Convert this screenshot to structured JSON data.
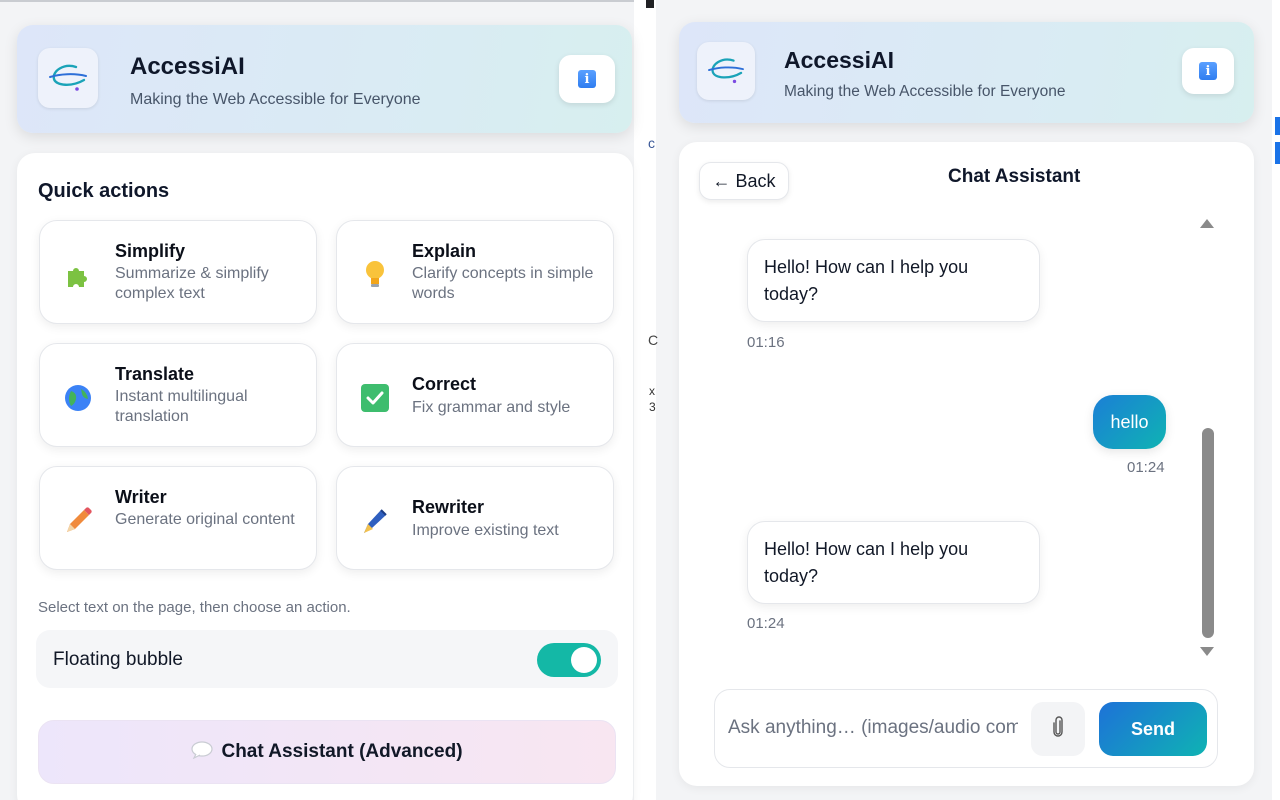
{
  "app": {
    "title": "AccessiAI",
    "subtitle": "Making the Web Accessible for Everyone",
    "logo_icon": "orbit-logo-icon",
    "info_icon": "info-icon",
    "info_glyph": "i"
  },
  "left_panel": {
    "section_title": "Quick actions",
    "actions": [
      {
        "title": "Simplify",
        "description": "Summarize & simplify complex text",
        "icon": "puzzle-piece-icon"
      },
      {
        "title": "Explain",
        "description": "Clarify concepts in simple words",
        "icon": "lightbulb-icon"
      },
      {
        "title": "Translate",
        "description": "Instant multilingual translation",
        "icon": "globe-icon"
      },
      {
        "title": "Correct",
        "description": "Fix grammar and style",
        "icon": "checkmark-box-icon"
      },
      {
        "title": "Writer",
        "description": "Generate original content",
        "icon": "pencil-icon"
      },
      {
        "title": "Rewriter",
        "description": "Improve existing text",
        "icon": "pen-icon"
      }
    ],
    "hint": "Select text on the page, then choose an action.",
    "floating_bubble": {
      "label": "Floating bubble",
      "enabled": true
    },
    "chat_button": {
      "label": "Chat Assistant (Advanced)",
      "icon": "speech-bubble-icon"
    }
  },
  "chat_panel": {
    "back_label": "← Back",
    "title": "Chat Assistant",
    "messages": [
      {
        "role": "assistant",
        "text": "Hello! How can I help you today?",
        "time": "01:16"
      },
      {
        "role": "user",
        "text": "hello",
        "time": "01:24"
      },
      {
        "role": "assistant",
        "text": "Hello! How can I help you today?",
        "time": "01:24"
      }
    ],
    "input": {
      "placeholder": "Ask anything… (images/audio com",
      "value": ""
    },
    "attach_icon": "paperclip-icon",
    "send_label": "Send"
  },
  "background_page": {
    "fragments": [
      "c",
      "C",
      "x",
      "3"
    ]
  },
  "colors": {
    "accent_teal": "#14b8a6",
    "send_gradient_start": "#1d72d8",
    "send_gradient_end": "#0fb3b3"
  }
}
